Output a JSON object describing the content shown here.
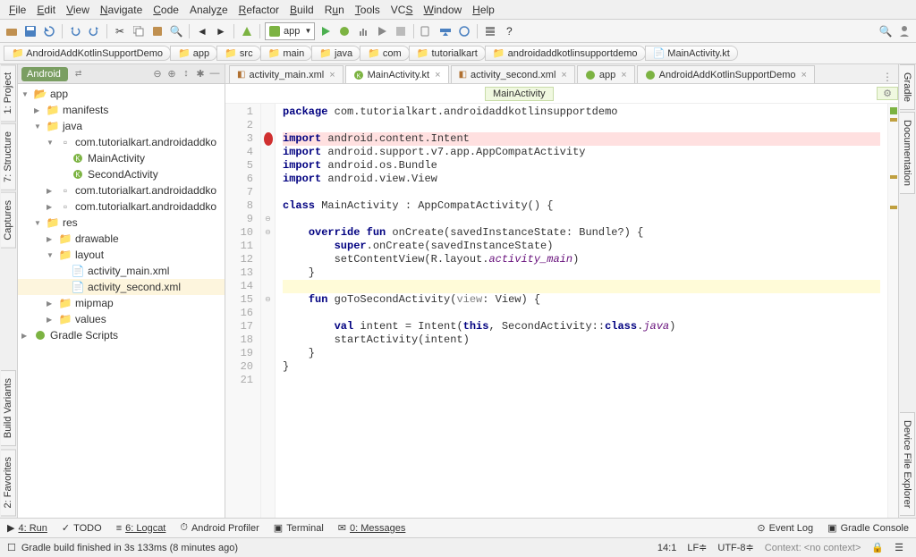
{
  "menu": [
    "File",
    "Edit",
    "View",
    "Navigate",
    "Code",
    "Analyze",
    "Refactor",
    "Build",
    "Run",
    "Tools",
    "VCS",
    "Window",
    "Help"
  ],
  "run_config": "app",
  "breadcrumb": [
    "AndroidAddKotlinSupportDemo",
    "app",
    "src",
    "main",
    "java",
    "com",
    "tutorialkart",
    "androidaddkotlinsupportdemo",
    "MainActivity.kt"
  ],
  "project_tab": "Android",
  "tree": [
    {
      "d": 0,
      "t": "folder-open",
      "label": "app",
      "arrow": "▼"
    },
    {
      "d": 1,
      "t": "folder",
      "label": "manifests",
      "arrow": "▶"
    },
    {
      "d": 1,
      "t": "folder-blue",
      "label": "java",
      "arrow": "▼"
    },
    {
      "d": 2,
      "t": "pkg",
      "label": "com.tutorialkart.androidaddko",
      "arrow": "▼"
    },
    {
      "d": 3,
      "t": "kt",
      "label": "MainActivity",
      "arrow": ""
    },
    {
      "d": 3,
      "t": "kt",
      "label": "SecondActivity",
      "arrow": ""
    },
    {
      "d": 2,
      "t": "pkg",
      "label": "com.tutorialkart.androidaddko",
      "arrow": "▶"
    },
    {
      "d": 2,
      "t": "pkg",
      "label": "com.tutorialkart.androidaddko",
      "arrow": "▶"
    },
    {
      "d": 1,
      "t": "folder",
      "label": "res",
      "arrow": "▼"
    },
    {
      "d": 2,
      "t": "folder",
      "label": "drawable",
      "arrow": "▶"
    },
    {
      "d": 2,
      "t": "folder",
      "label": "layout",
      "arrow": "▼"
    },
    {
      "d": 3,
      "t": "xml",
      "label": "activity_main.xml",
      "arrow": ""
    },
    {
      "d": 3,
      "t": "xml",
      "label": "activity_second.xml",
      "arrow": "",
      "sel": true
    },
    {
      "d": 2,
      "t": "folder",
      "label": "mipmap",
      "arrow": "▶"
    },
    {
      "d": 2,
      "t": "folder",
      "label": "values",
      "arrow": "▶"
    },
    {
      "d": 0,
      "t": "gradle",
      "label": "Gradle Scripts",
      "arrow": "▶"
    }
  ],
  "editor_tabs": [
    {
      "label": "activity_main.xml",
      "icon": "xml"
    },
    {
      "label": "MainActivity.kt",
      "icon": "kt",
      "active": true
    },
    {
      "label": "activity_second.xml",
      "icon": "xml"
    },
    {
      "label": "app",
      "icon": "gradle"
    },
    {
      "label": "AndroidAddKotlinSupportDemo",
      "icon": "gradle"
    }
  ],
  "class_nav": "MainActivity",
  "code_lines": 21,
  "code": {
    "l1": {
      "kw": "package",
      "rest": " com.tutorialkart.androidaddkotlinsupportdemo"
    },
    "l3": {
      "kw": "import",
      "rest": " android.content.Intent"
    },
    "l4": {
      "kw": "import",
      "rest": " android.support.v7.app.AppCompatActivity"
    },
    "l5": {
      "kw": "import",
      "rest": " android.os.Bundle"
    },
    "l6": {
      "kw": "import",
      "rest": " android.view.View"
    },
    "l8": {
      "kw": "class",
      "name": " MainActivity : AppCompatActivity() {"
    },
    "l10_a": "override fun",
    "l10_b": " onCreate(savedInstanceState: Bundle?) {",
    "l11_a": "super",
    "l11_b": ".onCreate(savedInstanceState)",
    "l12_a": "        setContentView(R.layout.",
    "l12_i": "activity_main",
    "l12_b": ")",
    "l13": "    }",
    "l15_a": "fun",
    "l15_b": " goToSecondActivity(",
    "l15_p": "view",
    "l15_c": ": View) {",
    "l17_a": "val",
    "l17_b": " intent = Intent(",
    "l17_c": "this",
    "l17_d": ", SecondActivity::",
    "l17_e": "class",
    "l17_f": ".",
    "l17_i": "java",
    "l17_g": ")",
    "l18": "        startActivity(intent)",
    "l19": "    }",
    "l20": "}"
  },
  "left_tabs": [
    "1: Project",
    "7: Structure",
    "Captures",
    "Build Variants",
    "2: Favorites"
  ],
  "right_tabs": [
    "Gradle",
    "Documentation",
    "Device File Explorer"
  ],
  "bottom_tools": [
    "4: Run",
    "TODO",
    "6: Logcat",
    "Android Profiler",
    "Terminal",
    "0: Messages"
  ],
  "bottom_right": [
    "Event Log",
    "Gradle Console"
  ],
  "status_msg": "Gradle build finished in 3s 133ms (8 minutes ago)",
  "status_pos": "14:1",
  "status_le": "LF≑",
  "status_enc": "UTF-8≑",
  "status_ctx": "Context: <no context>"
}
